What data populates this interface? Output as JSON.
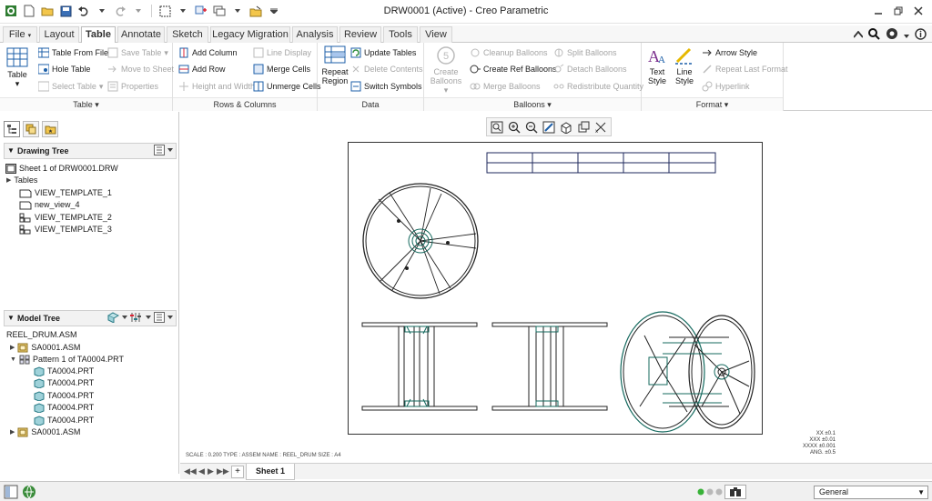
{
  "window": {
    "title": "DRW0001 (Active) - Creo Parametric"
  },
  "tabs": [
    "File",
    "Layout",
    "Table",
    "Annotate",
    "Sketch",
    "Legacy Migration",
    "Analysis",
    "Review",
    "Tools",
    "View"
  ],
  "ribbon": {
    "table_group": {
      "label": "Table",
      "table_btn": "Table",
      "table_from_file": "Table From File",
      "hole_table": "Hole Table",
      "select_table": "Select Table",
      "save_table": "Save Table",
      "move_to_sheet": "Move to Sheet",
      "properties": "Properties"
    },
    "rows_group": {
      "label": "Rows & Columns",
      "add_column": "Add Column",
      "add_row": "Add Row",
      "height_width": "Height and Width",
      "line_display": "Line Display",
      "merge_cells": "Merge Cells",
      "unmerge_cells": "Unmerge Cells"
    },
    "data_group": {
      "label": "Data",
      "repeat_region_1": "Repeat",
      "repeat_region_2": "Region",
      "update_tables": "Update Tables",
      "delete_contents": "Delete Contents",
      "switch_symbols": "Switch Symbols"
    },
    "balloons_group": {
      "label": "Balloons",
      "create_balloons_1": "Create",
      "create_balloons_2": "Balloons",
      "balloon_number": "5",
      "cleanup": "Cleanup Balloons",
      "create_ref": "Create Ref Balloons",
      "merge": "Merge Balloons",
      "split": "Split Balloons",
      "detach": "Detach Balloons",
      "redistribute": "Redistribute Quantity"
    },
    "format_group": {
      "label": "Format",
      "text_style_1": "Text",
      "text_style_2": "Style",
      "line_style_1": "Line",
      "line_style_2": "Style",
      "arrow_style": "Arrow Style",
      "repeat_last": "Repeat Last Format",
      "hyperlink": "Hyperlink"
    }
  },
  "drawing_tree": {
    "title": "Drawing Tree",
    "items": [
      "Sheet 1 of DRW0001.DRW",
      "Tables",
      "VIEW_TEMPLATE_1",
      "new_view_4",
      "VIEW_TEMPLATE_2",
      "VIEW_TEMPLATE_3"
    ]
  },
  "model_tree": {
    "title": "Model Tree",
    "items": [
      "REEL_DRUM.ASM",
      "SA0001.ASM",
      "Pattern 1 of TA0004.PRT",
      "TA0004.PRT",
      "TA0004.PRT",
      "TA0004.PRT",
      "TA0004.PRT",
      "TA0004.PRT",
      "SA0001.ASM"
    ]
  },
  "drawing": {
    "info_strip": "SCALE : 0.200   TYPE : ASSEM   NAME : REEL_DRUM   SIZE : A4",
    "tolerances": [
      "XX  ±0.1",
      "XXX  ±0.01",
      "XXXX  ±0.001",
      "ANG.  ±0.5"
    ]
  },
  "sheet_tab": "Sheet 1",
  "status": {
    "filter": "General"
  },
  "colors": {
    "accent": "#1c5fa8",
    "model_edge": "#14695e",
    "tab_border": "#bdbdbd"
  }
}
